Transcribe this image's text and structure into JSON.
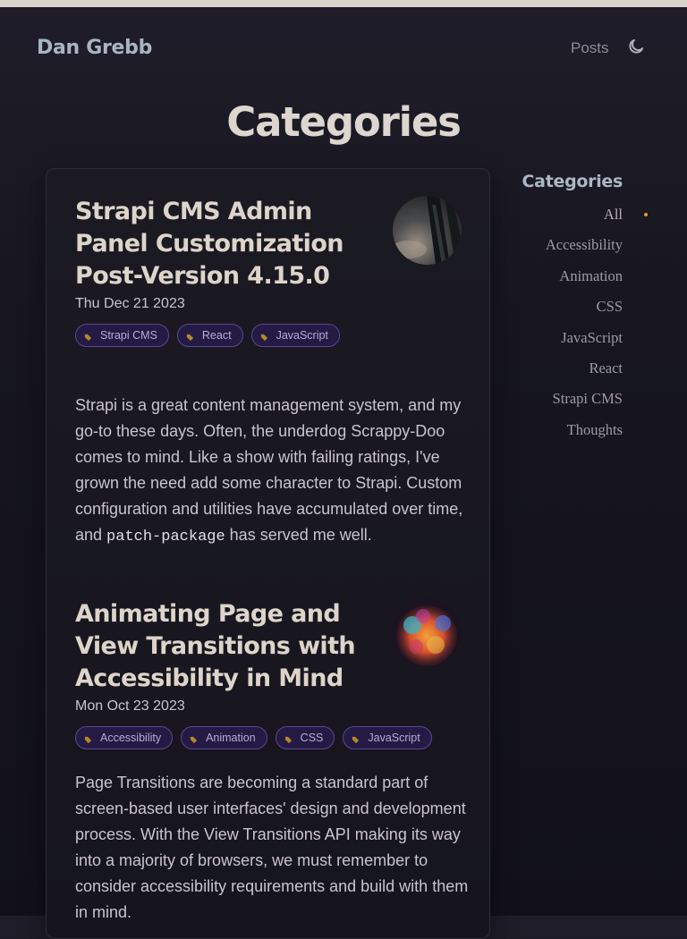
{
  "site": {
    "title": "Dan Grebb"
  },
  "nav": {
    "posts_label": "Posts",
    "theme_icon": "moon-icon"
  },
  "page": {
    "title": "Categories"
  },
  "posts": [
    {
      "title": "Strapi CMS Admin Panel Customization Post-Version 4.15.0",
      "date": "Thu Dec 21 2023",
      "tags": [
        "Strapi CMS",
        "React",
        "JavaScript"
      ],
      "excerpt_parts": [
        "Strapi is a great content management system, and my go-to these days. Often, the underdog Scrappy-Doo",
        "comes to mind. Like a show with failing ratings, I've grown the need add some character to Strapi. Custom configuration and utilities have accumulated over time, and ",
        "patch-package",
        " has served me well."
      ]
    },
    {
      "title": "Animating Page and View Transitions with Accessibility in Mind",
      "date": "Mon Oct 23 2023",
      "tags": [
        "Accessibility",
        "Animation",
        "CSS",
        "JavaScript"
      ],
      "excerpt": "Page Transitions are becoming a standard part of screen-based user interfaces' design and development process. With the View Transitions API making its way into a majority of browsers, we must remember to consider accessibility requirements and build with them in mind."
    }
  ],
  "sidebar": {
    "title": "Categories",
    "categories": [
      "All",
      "Accessibility",
      "Animation",
      "CSS",
      "JavaScript",
      "React",
      "Strapi CMS",
      "Thoughts"
    ],
    "active": "All"
  },
  "colors": {
    "accent_dot": "#e09a2f",
    "tag_border": "#5b4596",
    "tag_bg": "#241b45",
    "tag_icon": "#b8862a"
  }
}
